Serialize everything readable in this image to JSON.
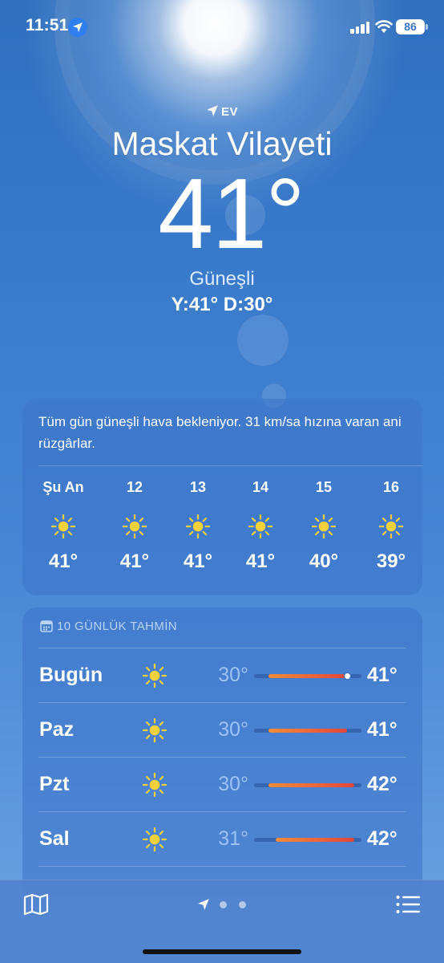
{
  "status_bar": {
    "time": "11:51",
    "battery": "86",
    "icons": [
      "location-arrow-icon",
      "signal-icon",
      "wifi-icon",
      "battery-icon"
    ]
  },
  "header": {
    "home_label": "EV",
    "city": "Maskat Vilayeti",
    "temperature": "41°",
    "condition": "Güneşli",
    "high_low": "Y:41° D:30°"
  },
  "hourly": {
    "summary": "Tüm gün güneşli hava bekleniyor. 31 km/sa hızına varan ani rüzgârlar.",
    "items": [
      {
        "label": "Şu An",
        "temp": "41°",
        "icon": "sun-icon"
      },
      {
        "label": "12",
        "temp": "41°",
        "icon": "sun-icon"
      },
      {
        "label": "13",
        "temp": "41°",
        "icon": "sun-icon"
      },
      {
        "label": "14",
        "temp": "41°",
        "icon": "sun-icon"
      },
      {
        "label": "15",
        "temp": "40°",
        "icon": "sun-icon"
      },
      {
        "label": "16",
        "temp": "39°",
        "icon": "sun-icon"
      }
    ]
  },
  "daily": {
    "title": "10 GÜNLÜK TAHMİN",
    "days": [
      {
        "day": "Bugün",
        "low": "30°",
        "high": "41°",
        "icon": "sun-icon",
        "range": [
          30,
          41
        ],
        "current": 41
      },
      {
        "day": "Paz",
        "low": "30°",
        "high": "41°",
        "icon": "sun-icon",
        "range": [
          30,
          41
        ]
      },
      {
        "day": "Pzt",
        "low": "30°",
        "high": "42°",
        "icon": "sun-icon",
        "range": [
          30,
          42
        ]
      },
      {
        "day": "Sal",
        "low": "31°",
        "high": "42°",
        "icon": "sun-icon",
        "range": [
          31,
          42
        ]
      }
    ],
    "scale": [
      28,
      43
    ]
  },
  "colors": {
    "sun": "#f7d13a",
    "bar_start": "#f28c3a",
    "bar_end": "#e2473a"
  },
  "bottom_bar": {
    "icons": [
      "map-icon",
      "location-arrow-icon",
      "page-dot-icon",
      "page-dot-icon",
      "list-icon"
    ]
  }
}
